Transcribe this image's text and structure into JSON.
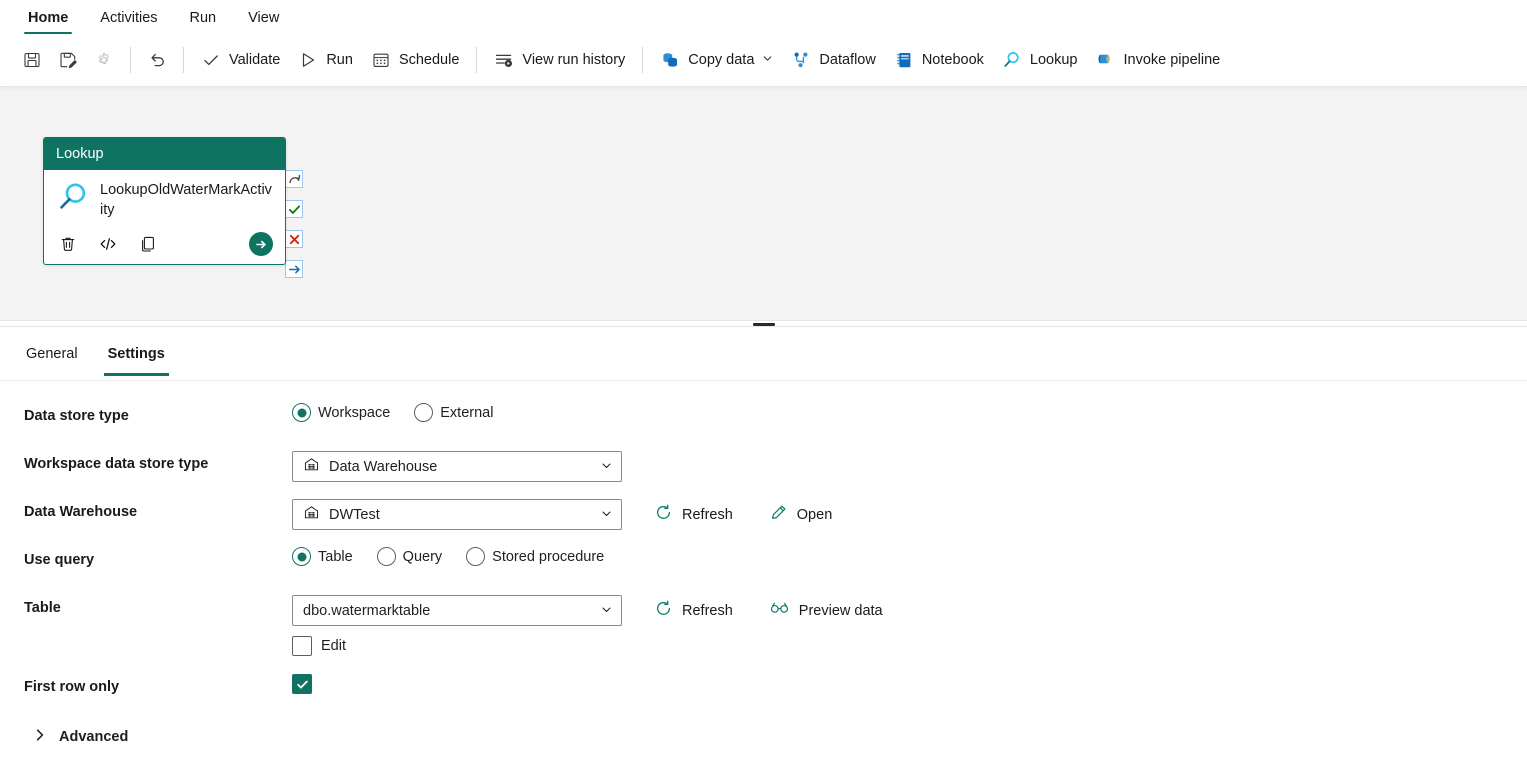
{
  "ribbon": {
    "tabs": [
      {
        "label": "Home",
        "active": true
      },
      {
        "label": "Activities",
        "active": false
      },
      {
        "label": "Run",
        "active": false
      },
      {
        "label": "View",
        "active": false
      }
    ]
  },
  "toolbar": {
    "save_label": "Save",
    "save_as_label": "Save as",
    "settings_label": "Settings",
    "undo_label": "Undo",
    "validate_label": "Validate",
    "run_label": "Run",
    "schedule_label": "Schedule",
    "view_run_history_label": "View run history",
    "copy_data_label": "Copy data",
    "dataflow_label": "Dataflow",
    "notebook_label": "Notebook",
    "lookup_label": "Lookup",
    "invoke_pipeline_label": "Invoke pipeline"
  },
  "canvas": {
    "node": {
      "header": "Lookup",
      "title": "LookupOldWaterMarkActivity",
      "icon": "lookup-magnifier-icon",
      "actions": {
        "delete": "delete-icon",
        "code": "code-icon",
        "copy": "copy-icon",
        "run": "run-activity-icon"
      },
      "handles": [
        {
          "name": "on-completion-handle",
          "glyph": "↷",
          "color": "#4a4a4a"
        },
        {
          "name": "on-success-handle",
          "glyph": "✔",
          "color": "#107c10"
        },
        {
          "name": "on-failure-handle",
          "glyph": "✖",
          "color": "#c42b1c"
        },
        {
          "name": "on-skip-handle",
          "glyph": "→",
          "color": "#0f6cbd"
        }
      ]
    }
  },
  "panel": {
    "tabs": [
      {
        "label": "General",
        "active": false
      },
      {
        "label": "Settings",
        "active": true
      }
    ],
    "fields": {
      "data_store_type": {
        "label": "Data store type",
        "options": [
          "Workspace",
          "External"
        ],
        "selected": "Workspace"
      },
      "workspace_data_store_type": {
        "label": "Workspace data store type",
        "value": "Data Warehouse",
        "icon": "warehouse-icon"
      },
      "data_warehouse": {
        "label": "Data Warehouse",
        "value": "DWTest",
        "icon": "warehouse-icon",
        "refresh_label": "Refresh",
        "open_label": "Open"
      },
      "use_query": {
        "label": "Use query",
        "options": [
          "Table",
          "Query",
          "Stored procedure"
        ],
        "selected": "Table"
      },
      "table": {
        "label": "Table",
        "value": "dbo.watermarktable",
        "refresh_label": "Refresh",
        "preview_label": "Preview data",
        "edit_label": "Edit",
        "edit_checked": false
      },
      "first_row_only": {
        "label": "First row only",
        "checked": true
      },
      "advanced": {
        "label": "Advanced",
        "expanded": false
      }
    }
  },
  "colors": {
    "accent": "#0f7362",
    "tab_underline": "#0f7362",
    "canvas_bg": "#f3f3f3",
    "link_teal": "#137d6e",
    "success": "#107c10",
    "failure": "#c42b1c",
    "skip": "#0f6cbd"
  }
}
